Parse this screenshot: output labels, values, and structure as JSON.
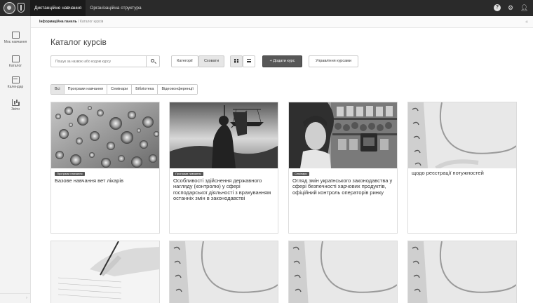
{
  "topbar": {
    "nav": [
      "Дистанційне навчання",
      "Організаційна структура"
    ],
    "icons": [
      "help-icon",
      "gear-icon",
      "user-icon"
    ]
  },
  "sidebar": {
    "items": [
      {
        "label": "Моє навчання",
        "icon": "learning-icon"
      },
      {
        "label": "Каталог",
        "icon": "catalog-icon"
      },
      {
        "label": "Календар",
        "icon": "calendar-icon"
      },
      {
        "label": "Звіти",
        "icon": "reports-icon"
      }
    ]
  },
  "breadcrumb": {
    "home": "Інформаційна панель",
    "separator": "/",
    "current": "Каталог курсів"
  },
  "page": {
    "title": "Каталог курсів",
    "search_placeholder": "Пошук за назвою або кодом курсу",
    "categories_label": "Категорії",
    "hide_label": "Сховати",
    "add_course_label": "+ Додати курс",
    "manage_courses_label": "Управління курсами"
  },
  "filters": [
    "Всі",
    "Програми навчання",
    "Семінари",
    "Бібліотека",
    "Відеоконференції"
  ],
  "cards": [
    {
      "tag": "Програми навчання",
      "title": "Базове навчання вет лікарів"
    },
    {
      "tag": "Програми навчання",
      "title": "Особливості здійснення державного нагляду (контролю) у сфері господарської діяльності з врахуванням останніх змін в законодавстві"
    },
    {
      "tag": "Семінари",
      "title": "Огляд змін українського законодавства у сфері безпечності харчових продуктів, офіційний контроль операторів ринку"
    },
    {
      "tag": "",
      "title": "щодо реєстрації потужностей"
    }
  ]
}
